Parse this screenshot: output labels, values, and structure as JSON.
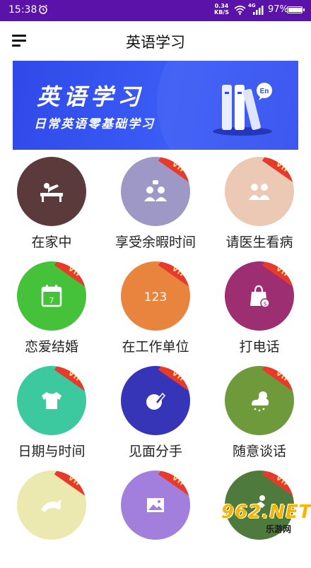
{
  "status_bar": {
    "time": "15:38",
    "net_speed_value": "0.34",
    "net_speed_unit": "KB/S",
    "network_type": "4G",
    "battery": "97%"
  },
  "app_bar": {
    "title": "英语学习"
  },
  "banner": {
    "title": "英语学习",
    "subtitle": "日常英语零基础学习",
    "badge": "En"
  },
  "vip_label": "VIP",
  "colors": {
    "status_bar": "#5a12a8",
    "banner": "#3b5cf5",
    "vip_ribbon": "#e83a2a"
  },
  "categories": [
    {
      "label": "在家中",
      "color": "#5a3a3a",
      "icon": "person-bed-icon",
      "vip": false
    },
    {
      "label": "享受余暇时间",
      "color": "#9d98c6",
      "icon": "people-talk-icon",
      "vip": true
    },
    {
      "label": "请医生看病",
      "color": "#ebc9b4",
      "icon": "family-icon",
      "vip": true
    },
    {
      "label": "恋爱结婚",
      "color": "#45c23a",
      "icon": "calendar-icon",
      "vip": true
    },
    {
      "label": "在工作单位",
      "color": "#e8843d",
      "icon": "numbers-icon",
      "vip": true
    },
    {
      "label": "打电话",
      "color": "#9e2e72",
      "icon": "shopping-bag-icon",
      "vip": true
    },
    {
      "label": "日期与时间",
      "color": "#3cc9a0",
      "icon": "tshirt-icon",
      "vip": true
    },
    {
      "label": "见面分手",
      "color": "#3635b8",
      "icon": "edit-icon",
      "vip": true
    },
    {
      "label": "随意谈话",
      "color": "#6e9a3c",
      "icon": "weather-icon",
      "vip": true
    },
    {
      "label": "",
      "color": "#ece9b0",
      "icon": "dolphin-icon",
      "vip": true
    },
    {
      "label": "",
      "color": "#a27fdc",
      "icon": "picture-icon",
      "vip": true
    },
    {
      "label": "",
      "color": "#4f7a3e",
      "icon": "activity-icon",
      "vip": true
    }
  ],
  "watermark": {
    "big": "962.NET",
    "small": "乐游网"
  }
}
